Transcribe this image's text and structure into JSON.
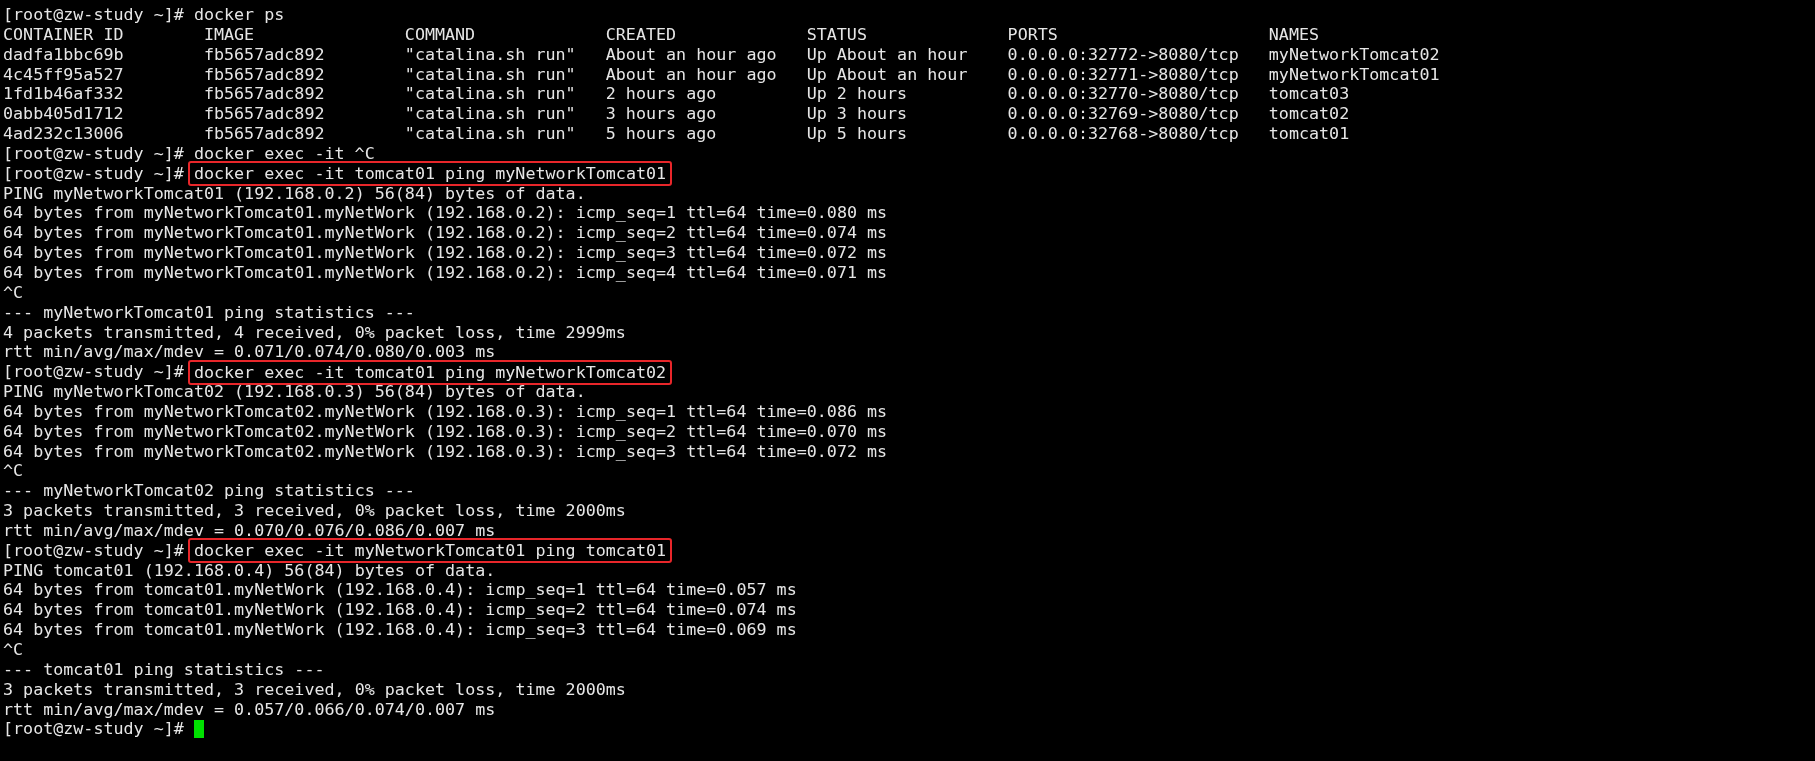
{
  "terminal": {
    "lines": [
      {
        "kind": "prompt",
        "prompt": "[root@zw-study ~]#",
        "command": "docker ps",
        "highlighted": false,
        "cursor": false
      },
      {
        "kind": "table",
        "columns": [
          "CONTAINER ID",
          "IMAGE",
          "COMMAND",
          "CREATED",
          "STATUS",
          "PORTS",
          "NAMES"
        ],
        "rows": [
          [
            "dadfa1bbc69b",
            "fb5657adc892",
            "\"catalina.sh run\"",
            "About an hour ago",
            "Up About an hour",
            "0.0.0.0:32772->8080/tcp",
            "myNetworkTomcat02"
          ],
          [
            "4c45ff95a527",
            "fb5657adc892",
            "\"catalina.sh run\"",
            "About an hour ago",
            "Up About an hour",
            "0.0.0.0:32771->8080/tcp",
            "myNetworkTomcat01"
          ],
          [
            "1fd1b46af332",
            "fb5657adc892",
            "\"catalina.sh run\"",
            "2 hours ago",
            "Up 2 hours",
            "0.0.0.0:32770->8080/tcp",
            "tomcat03"
          ],
          [
            "0abb405d1712",
            "fb5657adc892",
            "\"catalina.sh run\"",
            "3 hours ago",
            "Up 3 hours",
            "0.0.0.0:32769->8080/tcp",
            "tomcat02"
          ],
          [
            "4ad232c13006",
            "fb5657adc892",
            "\"catalina.sh run\"",
            "5 hours ago",
            "Up 5 hours",
            "0.0.0.0:32768->8080/tcp",
            "tomcat01"
          ]
        ]
      },
      {
        "kind": "prompt",
        "prompt": "[root@zw-study ~]#",
        "command": "docker exec -it ^C",
        "highlighted": false,
        "cursor": false
      },
      {
        "kind": "prompt",
        "prompt": "[root@zw-study ~]#",
        "command": "docker exec -it tomcat01 ping myNetworkTomcat01",
        "highlighted": true,
        "cursor": false
      },
      {
        "kind": "output",
        "text": "PING myNetworkTomcat01 (192.168.0.2) 56(84) bytes of data."
      },
      {
        "kind": "output",
        "text": "64 bytes from myNetworkTomcat01.myNetWork (192.168.0.2): icmp_seq=1 ttl=64 time=0.080 ms"
      },
      {
        "kind": "output",
        "text": "64 bytes from myNetworkTomcat01.myNetWork (192.168.0.2): icmp_seq=2 ttl=64 time=0.074 ms"
      },
      {
        "kind": "output",
        "text": "64 bytes from myNetworkTomcat01.myNetWork (192.168.0.2): icmp_seq=3 ttl=64 time=0.072 ms"
      },
      {
        "kind": "output",
        "text": "64 bytes from myNetworkTomcat01.myNetWork (192.168.0.2): icmp_seq=4 ttl=64 time=0.071 ms"
      },
      {
        "kind": "output",
        "text": "^C"
      },
      {
        "kind": "output",
        "text": "--- myNetworkTomcat01 ping statistics ---"
      },
      {
        "kind": "output",
        "text": "4 packets transmitted, 4 received, 0% packet loss, time 2999ms"
      },
      {
        "kind": "output",
        "text": "rtt min/avg/max/mdev = 0.071/0.074/0.080/0.003 ms"
      },
      {
        "kind": "prompt",
        "prompt": "[root@zw-study ~]#",
        "command": "docker exec -it tomcat01 ping myNetworkTomcat02",
        "highlighted": true,
        "cursor": false
      },
      {
        "kind": "output",
        "text": "PING myNetworkTomcat02 (192.168.0.3) 56(84) bytes of data."
      },
      {
        "kind": "output",
        "text": "64 bytes from myNetworkTomcat02.myNetWork (192.168.0.3): icmp_seq=1 ttl=64 time=0.086 ms"
      },
      {
        "kind": "output",
        "text": "64 bytes from myNetworkTomcat02.myNetWork (192.168.0.3): icmp_seq=2 ttl=64 time=0.070 ms"
      },
      {
        "kind": "output",
        "text": "64 bytes from myNetworkTomcat02.myNetWork (192.168.0.3): icmp_seq=3 ttl=64 time=0.072 ms"
      },
      {
        "kind": "output",
        "text": "^C"
      },
      {
        "kind": "output",
        "text": "--- myNetworkTomcat02 ping statistics ---"
      },
      {
        "kind": "output",
        "text": "3 packets transmitted, 3 received, 0% packet loss, time 2000ms"
      },
      {
        "kind": "output",
        "text": "rtt min/avg/max/mdev = 0.070/0.076/0.086/0.007 ms"
      },
      {
        "kind": "prompt",
        "prompt": "[root@zw-study ~]#",
        "command": "docker exec -it myNetworkTomcat01 ping tomcat01",
        "highlighted": true,
        "cursor": false
      },
      {
        "kind": "output",
        "text": "PING tomcat01 (192.168.0.4) 56(84) bytes of data."
      },
      {
        "kind": "output",
        "text": "64 bytes from tomcat01.myNetWork (192.168.0.4): icmp_seq=1 ttl=64 time=0.057 ms"
      },
      {
        "kind": "output",
        "text": "64 bytes from tomcat01.myNetWork (192.168.0.4): icmp_seq=2 ttl=64 time=0.074 ms"
      },
      {
        "kind": "output",
        "text": "64 bytes from tomcat01.myNetWork (192.168.0.4): icmp_seq=3 ttl=64 time=0.069 ms"
      },
      {
        "kind": "output",
        "text": "^C"
      },
      {
        "kind": "output",
        "text": "--- tomcat01 ping statistics ---"
      },
      {
        "kind": "output",
        "text": "3 packets transmitted, 3 received, 0% packet loss, time 2000ms"
      },
      {
        "kind": "output",
        "text": "rtt min/avg/max/mdev = 0.057/0.066/0.074/0.007 ms"
      },
      {
        "kind": "prompt",
        "prompt": "[root@zw-study ~]#",
        "cursor": true
      }
    ]
  }
}
